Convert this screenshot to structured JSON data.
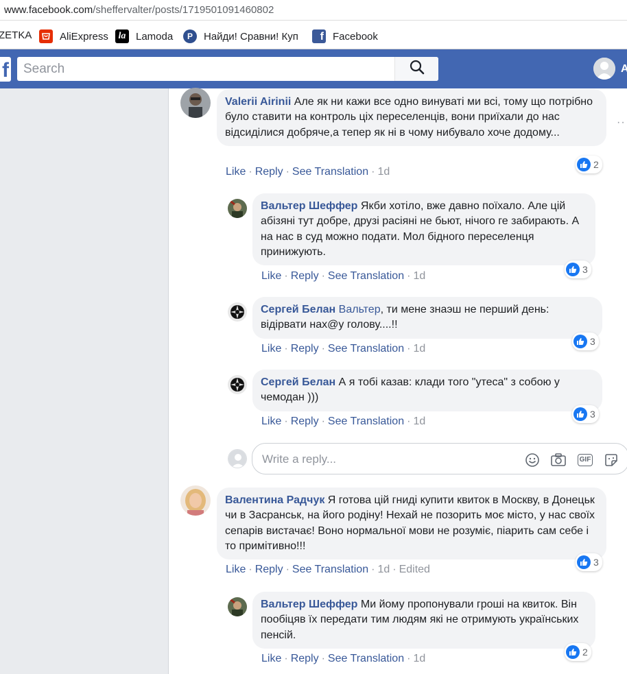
{
  "browser": {
    "url_host": "www.facebook.com",
    "url_path": "/sheffervalter/posts/1719501091460802"
  },
  "bookmarks": [
    {
      "label": "ZETKA",
      "icon": "bookmark-icon"
    },
    {
      "label": "AliExpress",
      "icon": "aliexpress-icon"
    },
    {
      "label": "Lamoda",
      "icon": "lamoda-icon",
      "icon_text": "la"
    },
    {
      "label": "Найди! Сравни! Куп",
      "icon": "price-compare-icon",
      "icon_text": "P"
    },
    {
      "label": "Facebook",
      "icon": "facebook-icon",
      "icon_text": "f"
    }
  ],
  "header": {
    "logo": "f",
    "search_placeholder": "Search",
    "profile_initial": "A"
  },
  "colors": {
    "facebook_blue": "#4267b2",
    "link_blue": "#385898",
    "like_blue": "#1877f2",
    "bubble_gray": "#f2f3f5"
  },
  "actions": {
    "like": "Like",
    "reply": "Reply",
    "see_translation": "See Translation",
    "dot": "·"
  },
  "comments": [
    {
      "author": "Valerii Airinii",
      "text": " Але як ни кажи все одно винуваті ми всі, тому що потрібно було ставити на контроль ціх переселенців, вони приїхали до нас відсиділися добряче,а тепер як ні в чому нибувало хоче додому...",
      "time": "1d",
      "reactions": "2"
    },
    {
      "author": "Вальтер Шеффер",
      "text": " Якби хотіло, вже давно поїхало. Але цій абізяні тут добре, друзі расіяні не бьют, нічого ге забирають. А на нас в суд можно подати. Мол бідного переселенця принижують.",
      "time": "1d",
      "reactions": "3"
    },
    {
      "author": "Сергей Белан",
      "mention": "Вальтер",
      "text": ", ти мене знаэш не перший день: відірвати нах@у голову....!!",
      "time": "1d",
      "reactions": "3"
    },
    {
      "author": "Сергей Белан",
      "text": " А я тобі казав: клади того \"утеса\" з собою у чемодан )))",
      "time": "1d",
      "reactions": "3"
    },
    {
      "author": "Валентина Радчук",
      "text": " Я готова цій гниді купити квиток в Москву, в Донецьк чи в Засранськ, на його родіну! Нехай не позорить моє місто, у нас своїх сепарів вистачає! Воно нормальної мови не розуміє, піарить сам себе і то примітивно!!!",
      "time": "1d",
      "edited": "Edited",
      "reactions": "3"
    },
    {
      "author": "Вальтер Шеффер",
      "text": " Ми йому пропонували гроші на квиток. Він пообіцяв їх передати тим людям які не отримують українських пенсій.",
      "time": "1d",
      "reactions": "2"
    }
  ],
  "reply_box": {
    "placeholder": "Write a reply...",
    "gif_label": "GIF"
  },
  "more_dots": "··"
}
